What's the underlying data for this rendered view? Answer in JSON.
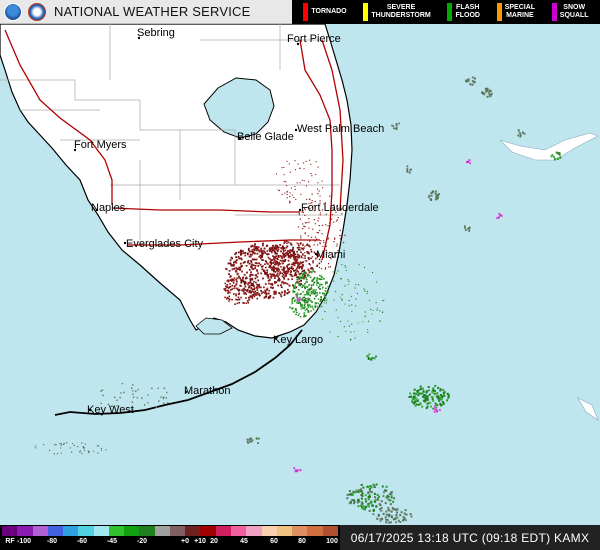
{
  "header": {
    "title": "NATIONAL WEATHER SERVICE",
    "warnings": [
      {
        "label": "TORNADO",
        "color": "#ff0000"
      },
      {
        "label": "SEVERE\nTHUNDERSTORM",
        "color": "#ffff00"
      },
      {
        "label": "FLASH\nFLOOD",
        "color": "#00aa00"
      },
      {
        "label": "SPECIAL\nMARINE",
        "color": "#ff9900"
      },
      {
        "label": "SNOW\nSQUALL",
        "color": "#cc00cc"
      }
    ]
  },
  "colors": {
    "water": "#bfe6ee",
    "land": "#ffffff",
    "highway": "#b00000",
    "coast": "#000000"
  },
  "cities": {
    "sebring": "Sebring",
    "fort_pierce": "Fort Pierce",
    "fort_myers": "Fort Myers",
    "belle_glade": "Belle Glade",
    "west_palm_beach": "West Palm Beach",
    "naples": "Naples",
    "fort_lauderdale": "Fort Lauderdale",
    "everglades_city": "Everglades City",
    "miami": "Miami",
    "key_largo": "Key Largo",
    "marathon": "Marathon",
    "key_west": "Key West"
  },
  "colorbar": {
    "prefix": "RF",
    "ticks": [
      "-100",
      "-80",
      "-60",
      "-45",
      "-20",
      "+0",
      "+10",
      "20",
      "45",
      "60",
      "80",
      "100"
    ],
    "colors": [
      "#6a0080",
      "#8a1ab0",
      "#b060d0",
      "#4060e0",
      "#30a0e0",
      "#50d0e0",
      "#a0e8f0",
      "#30c030",
      "#10a010",
      "#208020",
      "#a0a0a0",
      "#806060",
      "#702020",
      "#a00000",
      "#d02060",
      "#f060a0",
      "#f0a0c0",
      "#f8d0b0",
      "#f0c080",
      "#e09060",
      "#d07040",
      "#b05030"
    ]
  },
  "timestamp": "06/17/2025 13:18 UTC (09:18 EDT) KAMX"
}
